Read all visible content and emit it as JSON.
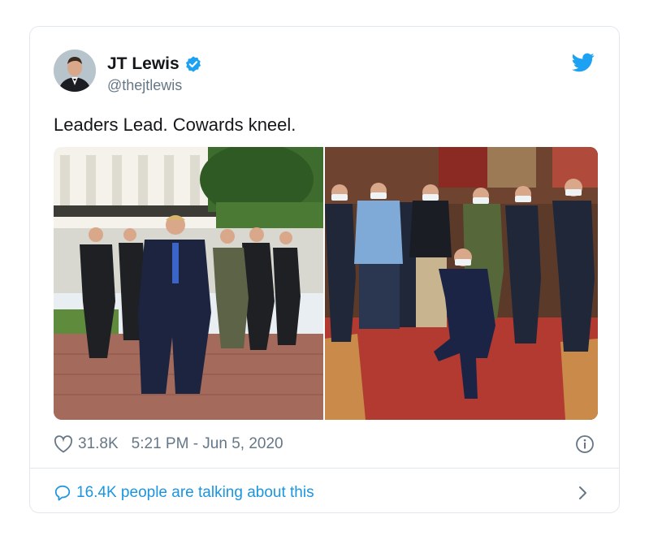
{
  "tweet": {
    "author_name": "JT Lewis",
    "handle": "@thejtlewis",
    "text": "Leaders Lead. Cowards kneel.",
    "likes": "31.8K",
    "timestamp": "5:21 PM - Jun 5, 2020",
    "conversation_text": "16.4K people are talking about this"
  },
  "icons": {
    "verified": "verified-badge-icon",
    "brand": "twitter-bird-icon",
    "like": "heart-icon",
    "info": "info-icon",
    "reply": "speech-bubble-icon",
    "more": "chevron-right-icon"
  },
  "colors": {
    "accent": "#1b95e0",
    "verified": "#1da1f2",
    "secondary_text": "#657786",
    "border": "#e1e8ed"
  }
}
